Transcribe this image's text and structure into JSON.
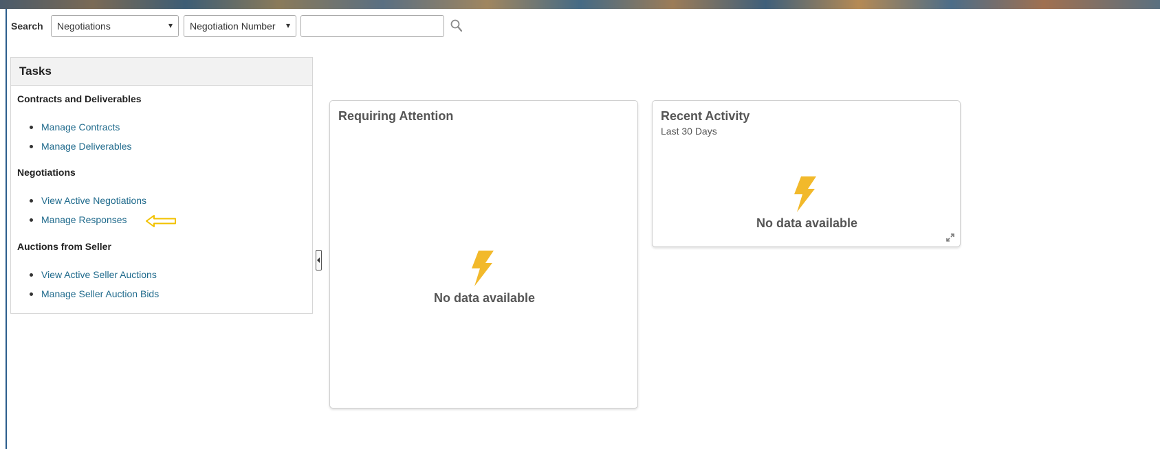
{
  "search": {
    "label": "Search",
    "category_value": "Negotiations",
    "attribute_value": "Negotiation Number",
    "text_value": "",
    "chevron": "▾"
  },
  "tasks": {
    "title": "Tasks",
    "sections": [
      {
        "title": "Contracts and Deliverables",
        "links": [
          "Manage Contracts",
          "Manage Deliverables"
        ]
      },
      {
        "title": "Negotiations",
        "links": [
          "View Active Negotiations",
          "Manage Responses"
        ]
      },
      {
        "title": "Auctions from Seller",
        "links": [
          "View Active Seller Auctions",
          "Manage Seller Auction Bids"
        ]
      }
    ]
  },
  "cards": {
    "requiring_attention": {
      "title": "Requiring Attention",
      "empty_text": "No data available"
    },
    "recent_activity": {
      "title": "Recent Activity",
      "subtitle": "Last 30 Days",
      "empty_text": "No data available"
    }
  },
  "colors": {
    "link": "#1f6a8c",
    "bolt": "#f2b92b",
    "annotation_arrow": "#f2c200",
    "sidebar_edge": "#2b5d8c"
  },
  "icons": {
    "search": "search-icon",
    "bolt": "lightning-bolt-icon",
    "expand": "expand-icon",
    "collapse": "collapse-panel-icon",
    "annotation": "arrow-left-annotation-icon"
  }
}
